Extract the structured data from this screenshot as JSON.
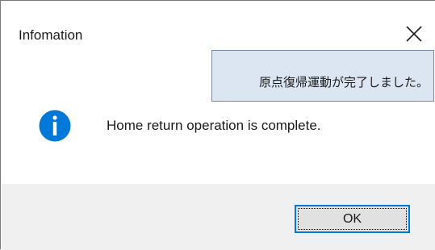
{
  "dialog": {
    "title": "Infomation",
    "close_icon": "close-icon",
    "tooltip_text": "原点復帰運動が完了しました。",
    "icon": "info-icon",
    "message": "Home return operation is complete.",
    "ok_label": "OK"
  },
  "colors": {
    "info_icon": "#0078d7",
    "footer_bg": "#f0f0f0",
    "tooltip_bg": "#dce6f2",
    "button_border": "#0078d7"
  }
}
